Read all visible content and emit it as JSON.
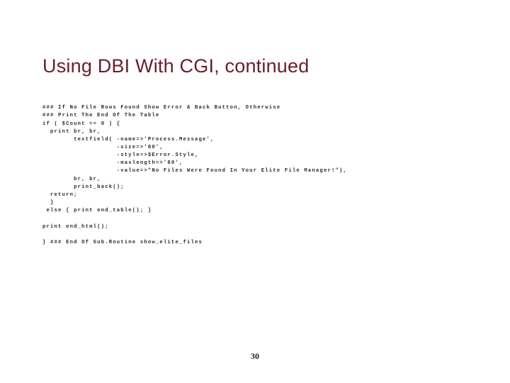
{
  "title": "Using DBI With CGI, continued",
  "page_number": "30",
  "code_lines": [
    "### If No File Rows Found Show Error & Back Button, Otherwise",
    "### Print The End Of The Table",
    "if ( $Count == 0 ) {",
    "  print br, br,",
    "        textfield( -name=>'Process.Message',",
    "                   -size=>'80',",
    "                   -style=>$Error.Style,",
    "                   -maxlength=>'80',",
    "                   -value=>\"No Files Were Found In Your Elite File Manager!\"),",
    "        br, br,",
    "        print_back();",
    "  return;",
    "  }",
    " else { print end_table(); }",
    "",
    "print end_html();",
    "",
    "} ### End Of Sub.Routine show_elite_files"
  ]
}
